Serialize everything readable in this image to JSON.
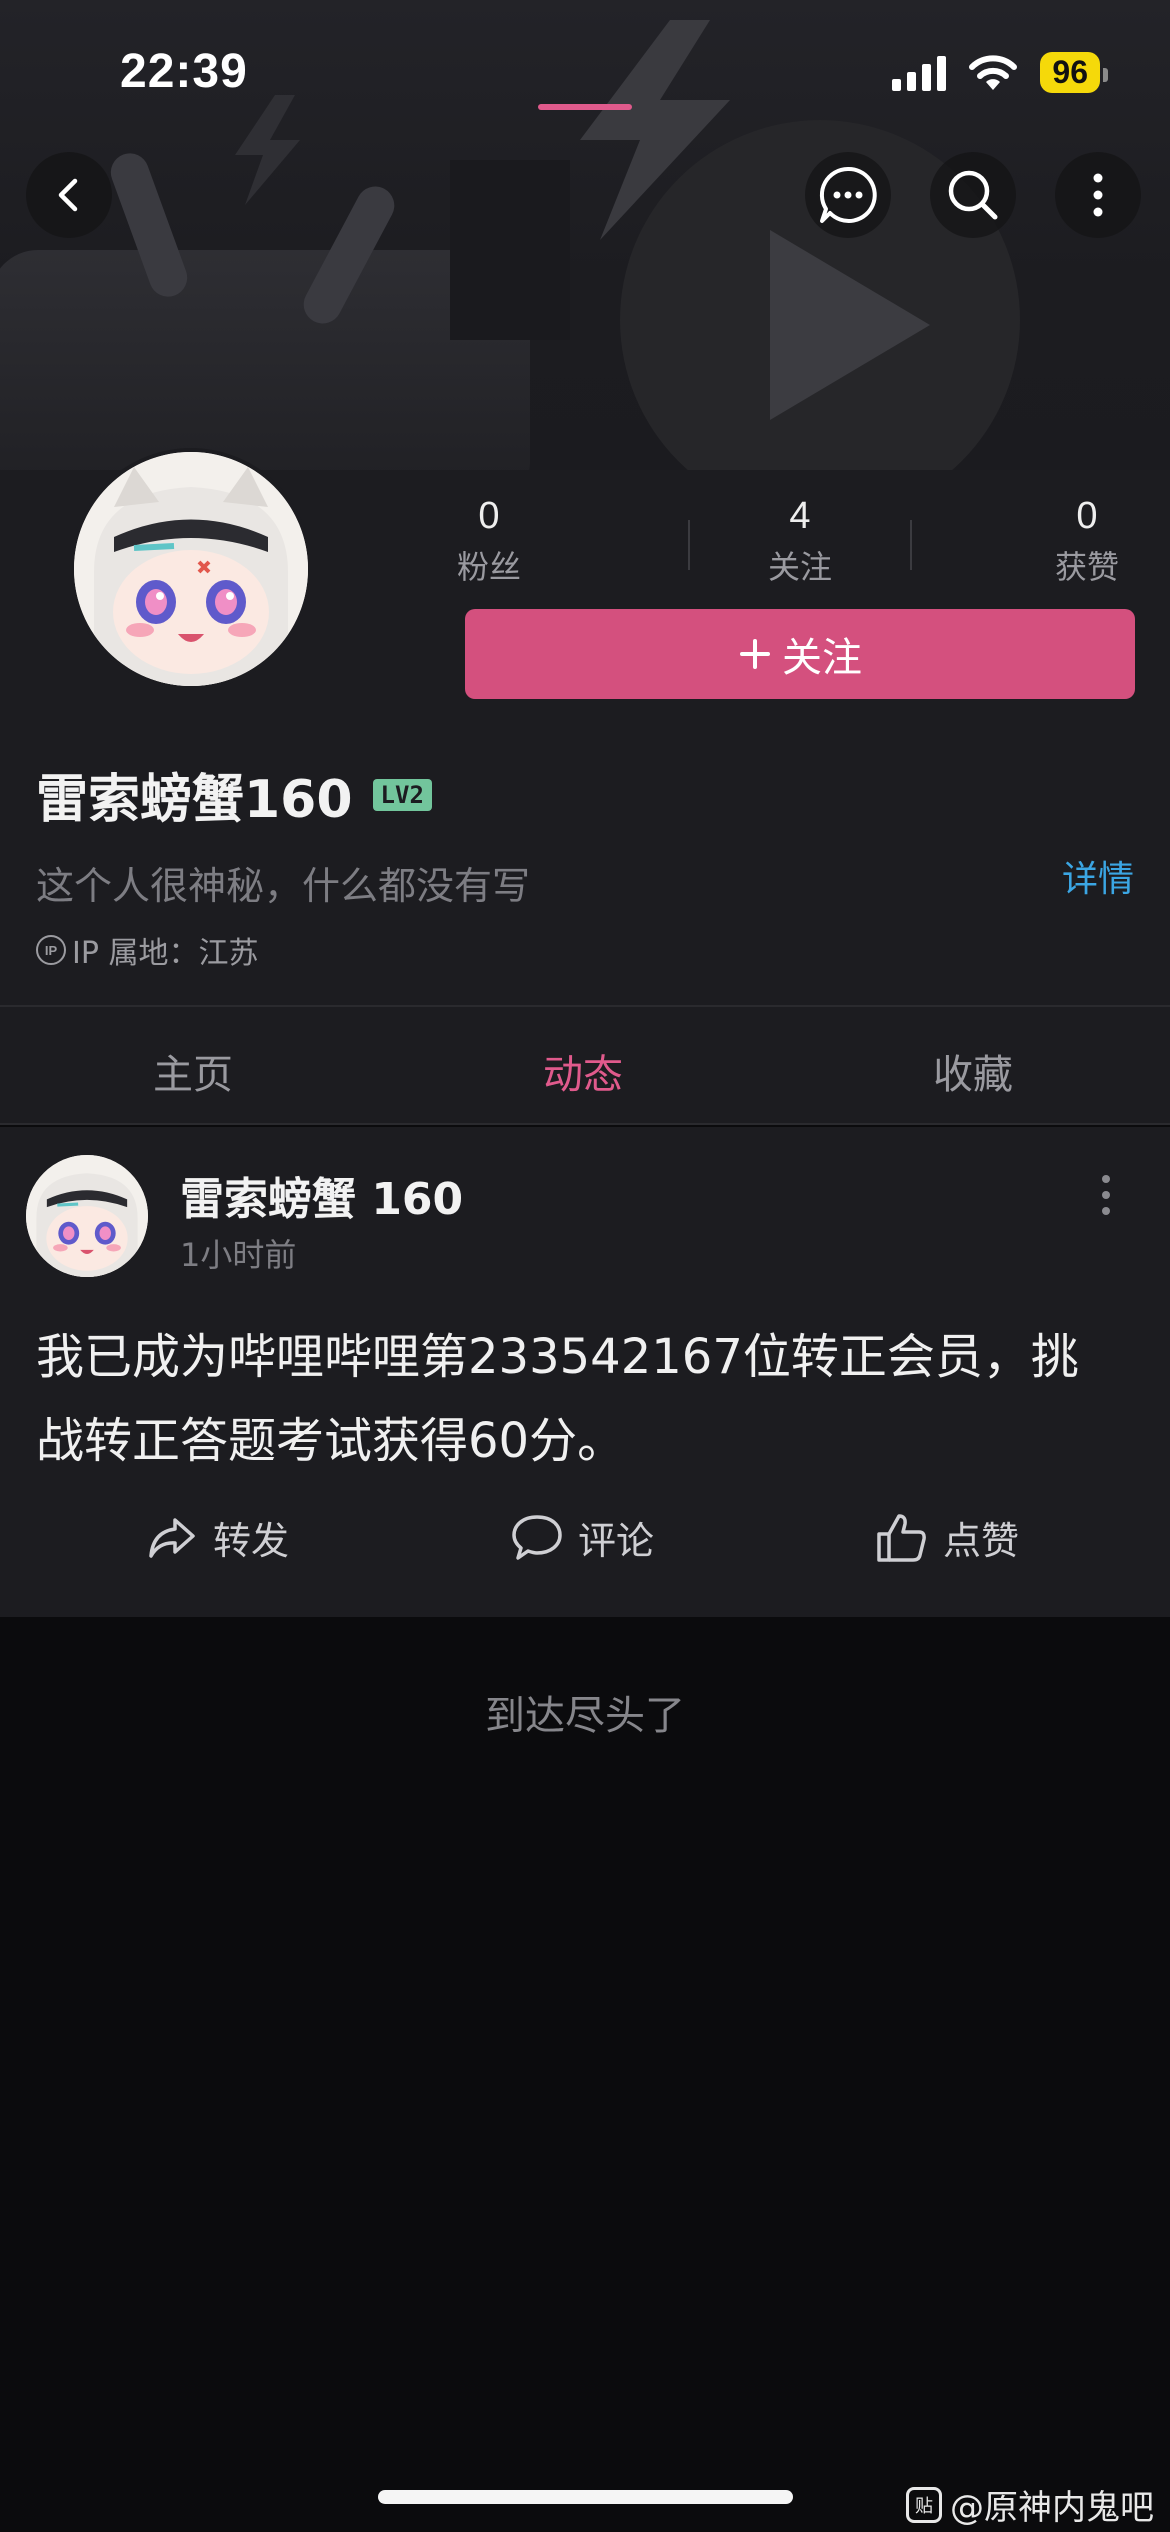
{
  "status_bar": {
    "time": "22:39",
    "battery": "96"
  },
  "profile": {
    "stats": [
      {
        "value": "0",
        "label": "粉丝"
      },
      {
        "value": "4",
        "label": "关注"
      },
      {
        "value": "0",
        "label": "获赞"
      }
    ],
    "follow_label": "关注",
    "username": "雷索螃蟹160",
    "level_badge": "LV2",
    "bio": "这个人很神秘，什么都没有写",
    "detail_label": "详情",
    "ip_icon_text": "IP",
    "ip_text": "IP 属地：江苏"
  },
  "tabs": [
    {
      "label": "主页"
    },
    {
      "label": "动态"
    },
    {
      "label": "收藏"
    }
  ],
  "active_tab": "动态",
  "post": {
    "author": "雷索螃蟹 160",
    "time": "1小时前",
    "text_line1": "我已成为哔哩哔哩第233542167位转正会员，挑",
    "text_line2": "战转正答题考试获得60分。",
    "actions": {
      "repost": "转发",
      "comment": "评论",
      "like": "点赞"
    }
  },
  "end_text": "到达尽头了",
  "watermark": {
    "icon_text": "贴",
    "text": "@原神内鬼吧"
  },
  "colors": {
    "accent": "#d4507e",
    "tab_active": "#e05a8c",
    "link": "#3ba6e4",
    "level_badge": "#72c59c",
    "battery": "#f5d90a"
  }
}
